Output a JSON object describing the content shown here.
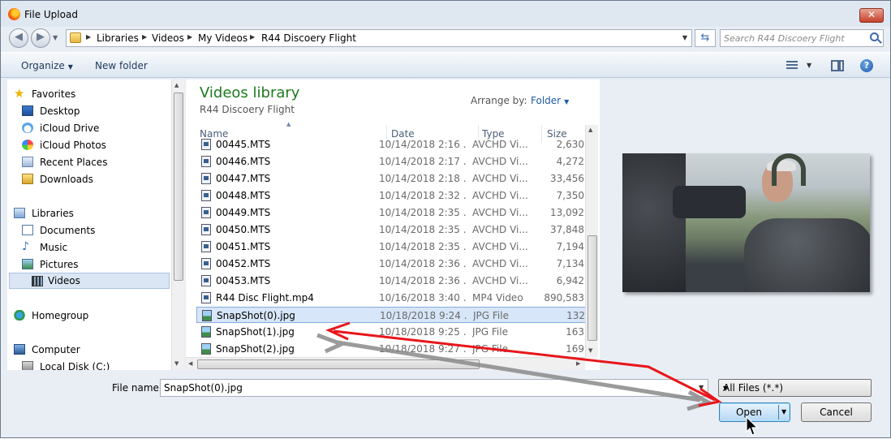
{
  "window": {
    "title": "File Upload",
    "close_label": "✕"
  },
  "address": {
    "crumbs": [
      "Libraries",
      "Videos",
      "My Videos",
      "R44 Discoery Flight"
    ],
    "search_placeholder": "Search R44 Discoery Flight"
  },
  "toolbar": {
    "organize": "Organize",
    "new_folder": "New folder"
  },
  "nav": {
    "items": [
      {
        "label": "Favorites",
        "icon": "star-icon"
      },
      {
        "label": "Desktop",
        "icon": "desktop-icon"
      },
      {
        "label": "iCloud Drive",
        "icon": "cloud-icon"
      },
      {
        "label": "iCloud Photos",
        "icon": "photos-icon"
      },
      {
        "label": "Recent Places",
        "icon": "recent-places-icon"
      },
      {
        "label": "Downloads",
        "icon": "downloads-folder-icon"
      },
      {
        "label": "Libraries",
        "icon": "libraries-icon"
      },
      {
        "label": "Documents",
        "icon": "documents-icon"
      },
      {
        "label": "Music",
        "icon": "music-icon"
      },
      {
        "label": "Pictures",
        "icon": "pictures-icon"
      },
      {
        "label": "Videos",
        "icon": "videos-icon"
      },
      {
        "label": "Homegroup",
        "icon": "homegroup-icon"
      },
      {
        "label": "Computer",
        "icon": "computer-icon"
      },
      {
        "label": "Local Disk (C:)",
        "icon": "disk-icon"
      }
    ]
  },
  "content": {
    "library_title": "Videos library",
    "library_subtitle": "R44 Discoery Flight",
    "arrange_label": "Arrange by:",
    "arrange_value": "Folder",
    "columns": [
      "Name",
      "Date",
      "Type",
      "Size"
    ],
    "rows": [
      {
        "name": "00445.MTS",
        "date": "10/14/2018 2:16 ...",
        "type": "AVCHD Vi...",
        "size": "2,630"
      },
      {
        "name": "00446.MTS",
        "date": "10/14/2018 2:17 ...",
        "type": "AVCHD Vi...",
        "size": "4,272"
      },
      {
        "name": "00447.MTS",
        "date": "10/14/2018 2:18 ...",
        "type": "AVCHD Vi...",
        "size": "33,456"
      },
      {
        "name": "00448.MTS",
        "date": "10/14/2018 2:32 ...",
        "type": "AVCHD Vi...",
        "size": "7,350"
      },
      {
        "name": "00449.MTS",
        "date": "10/14/2018 2:35 ...",
        "type": "AVCHD Vi...",
        "size": "13,092"
      },
      {
        "name": "00450.MTS",
        "date": "10/14/2018 2:35 ...",
        "type": "AVCHD Vi...",
        "size": "37,848"
      },
      {
        "name": "00451.MTS",
        "date": "10/14/2018 2:35 ...",
        "type": "AVCHD Vi...",
        "size": "7,194"
      },
      {
        "name": "00452.MTS",
        "date": "10/14/2018 2:36 ...",
        "type": "AVCHD Vi...",
        "size": "7,134"
      },
      {
        "name": "00453.MTS",
        "date": "10/14/2018 2:36 ...",
        "type": "AVCHD Vi...",
        "size": "6,942"
      },
      {
        "name": "R44 Disc Flight.mp4",
        "date": "10/16/2018 3:40 ...",
        "type": "MP4 Video",
        "size": "890,583"
      },
      {
        "name": "SnapShot(0).jpg",
        "date": "10/18/2018 9:24 ...",
        "type": "JPG File",
        "size": "132"
      },
      {
        "name": "SnapShot(1).jpg",
        "date": "10/18/2018 9:25 ...",
        "type": "JPG File",
        "size": "163"
      },
      {
        "name": "SnapShot(2).jpg",
        "date": "10/18/2018 9:27 ...",
        "type": "JPG File",
        "size": "169"
      }
    ],
    "selected_row": 10
  },
  "footer": {
    "file_name_label": "File name:",
    "file_name_value": "SnapShot(0).jpg",
    "filter_value": "All Files (*.*)",
    "open_label": "Open",
    "cancel_label": "Cancel"
  },
  "colors": {
    "accent": "#1e5aa8",
    "library_title": "#1e7a1e",
    "annotation_arrow": "#e8161b"
  }
}
